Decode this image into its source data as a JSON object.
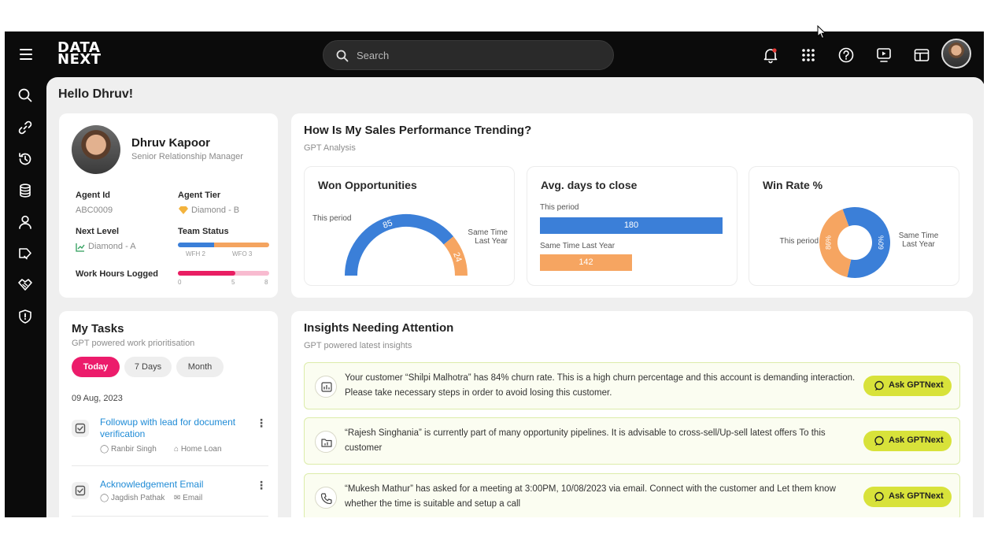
{
  "topbar": {
    "logo_line1": "DATA",
    "logo_line2": "NEXT",
    "search_placeholder": "Search",
    "icons": [
      "bell-icon",
      "apps-grid-icon",
      "help-icon",
      "presentation-icon",
      "layout-icon"
    ]
  },
  "sidebar": {
    "icons": [
      "search-icon",
      "link-icon",
      "history-icon",
      "database-icon",
      "user-icon",
      "tag-icon",
      "handshake-icon",
      "shield-icon"
    ]
  },
  "greeting": "Hello Dhruv!",
  "profile": {
    "name": "Dhruv Kapoor",
    "role": "Senior Relationship Manager",
    "agent_id_label": "Agent Id",
    "agent_id": "ABC0009",
    "agent_tier_label": "Agent Tier",
    "agent_tier": "Diamond - B",
    "next_level_label": "Next Level",
    "next_level": "Diamond - A",
    "team_status_label": "Team Status",
    "team_status": {
      "wfh_label": "WFH 2",
      "wfo_label": "WFO 3",
      "wfh": 2,
      "wfo": 3
    },
    "work_hours_label": "Work Hours Logged",
    "work_hours": {
      "logged": 5,
      "max": 8,
      "ticks": [
        "0",
        "5",
        "8"
      ]
    },
    "colors": {
      "wfh": "#3b7fd8",
      "wfo": "#f4a460",
      "hours": "#e91e63",
      "hours_track": "#f8bbd0"
    }
  },
  "sales": {
    "title": "How Is My Sales Performance Trending?",
    "subtitle": "GPT Analysis",
    "won": {
      "title": "Won Opportunities",
      "this_label": "This period",
      "last_label": "Same Time Last Year",
      "this_value": 85,
      "last_value": 24
    },
    "avg_days": {
      "title": "Avg. days to close",
      "this_label": "This period",
      "last_label": "Same Time Last Year",
      "this_value": 180,
      "last_value": 142
    },
    "win_rate": {
      "title": "Win Rate %",
      "this_label": "This period",
      "last_label": "Same Time Last Year",
      "this_value": "86%",
      "last_value": "60%",
      "this_share": 0.59
    },
    "colors": {
      "this": "#3b7fd8",
      "last": "#f6a561"
    }
  },
  "tasks": {
    "title": "My Tasks",
    "subtitle": "GPT powered work prioritisation",
    "filters": [
      "Today",
      "7 Days",
      "Month"
    ],
    "active_filter": "Today",
    "date": "09 Aug, 2023",
    "items": [
      {
        "title": "Followup with lead for document verification",
        "person": "Ranbir Singh",
        "category": "Home Loan"
      },
      {
        "title": "Acknowledgement Email",
        "person": "Jagdish Pathak",
        "category": "Email"
      }
    ]
  },
  "insights": {
    "title": "Insights Needing Attention",
    "subtitle": "GPT powered latest insights",
    "button_label": "Ask GPTNext",
    "items": [
      {
        "icon": "chart-icon",
        "text": "Your customer “Shilpi Malhotra” has 84% churn rate.  This is a high churn percentage and this account is demanding interaction.  Please take necessary steps in order to avoid losing this customer."
      },
      {
        "icon": "folder-chart-icon",
        "text": "“Rajesh Singhania” is currently part of many opportunity pipelines.  It is advisable to cross-sell/Up-sell latest offers To this customer"
      },
      {
        "icon": "phone-icon",
        "text": "“Mukesh Mathur” has asked for a meeting at 3:00PM, 10/08/2023 via email.  Connect with the customer and Let them know whether the time is suitable and setup a call"
      }
    ]
  }
}
